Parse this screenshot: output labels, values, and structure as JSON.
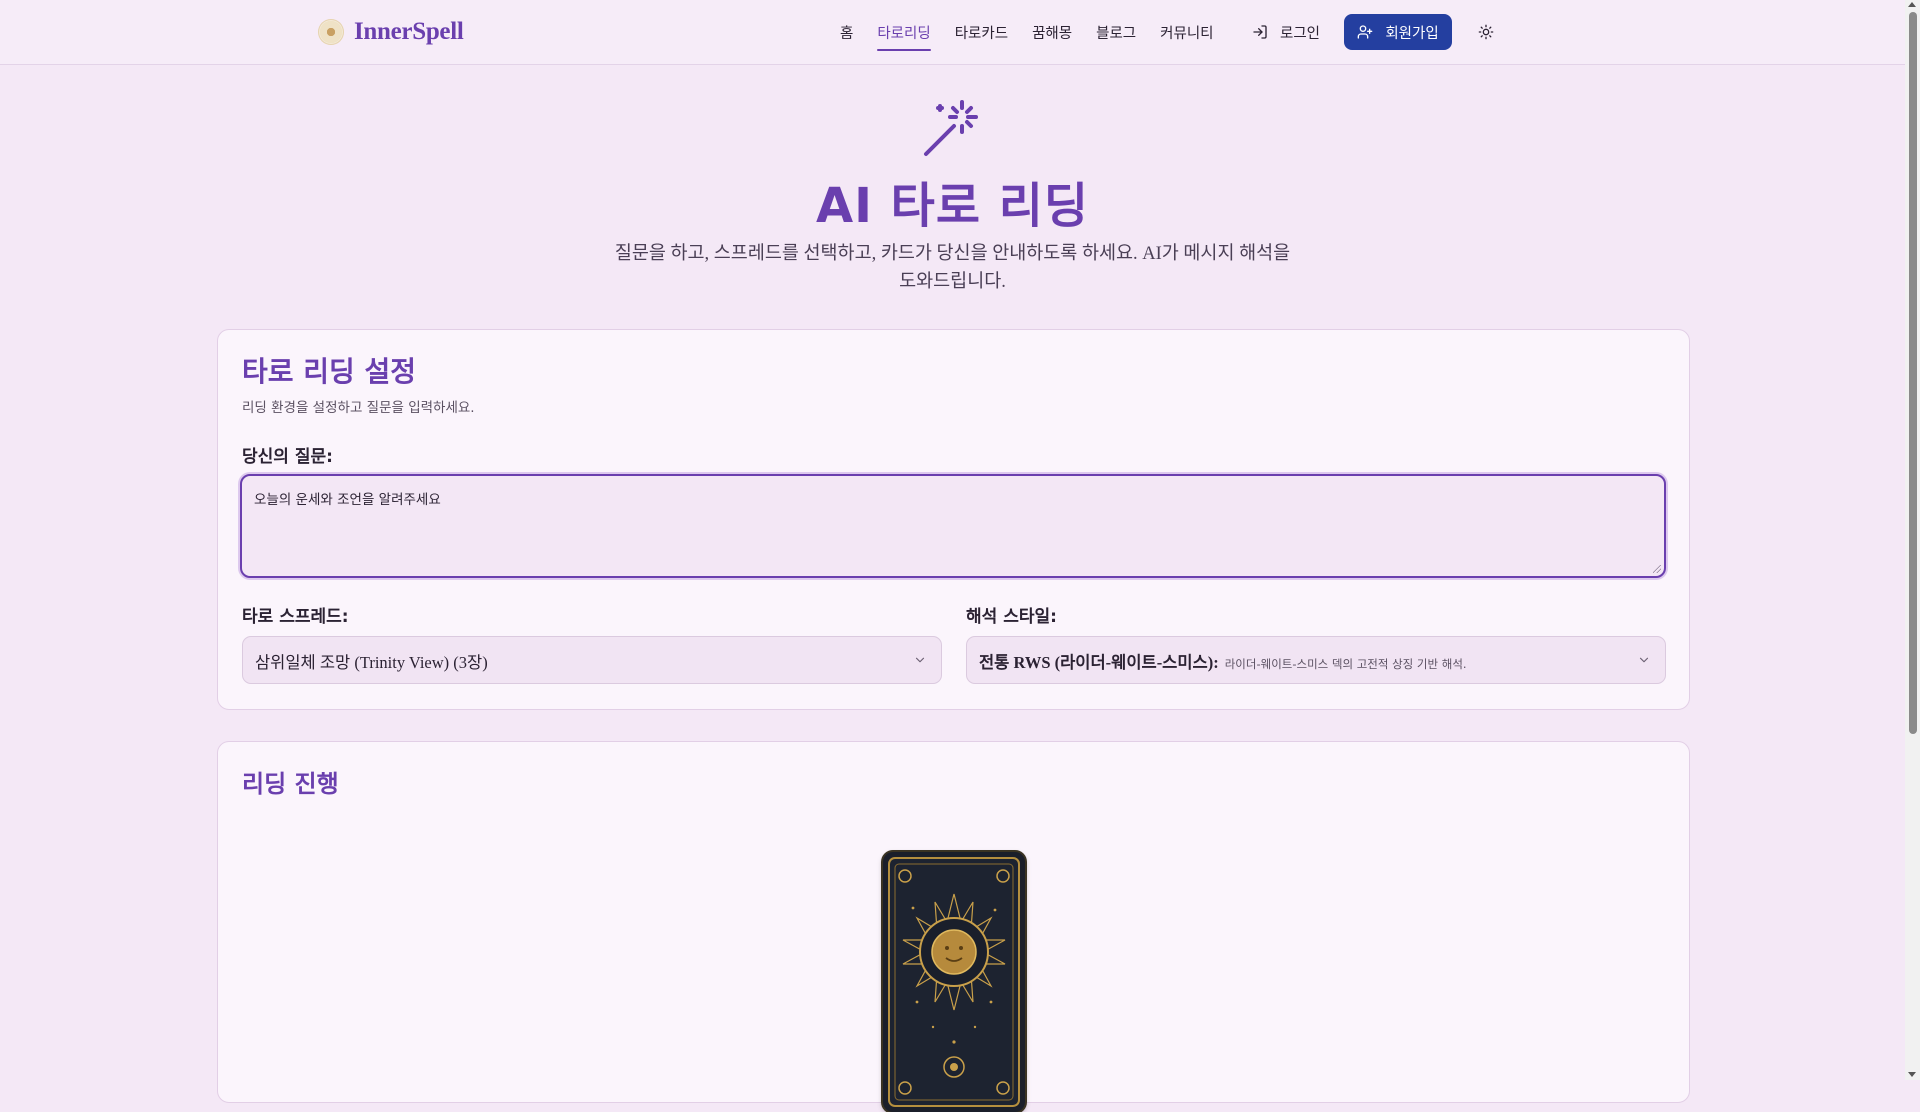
{
  "header": {
    "logo_text": "InnerSpell",
    "nav": [
      {
        "label": "홈",
        "active": false
      },
      {
        "label": "타로리딩",
        "active": true
      },
      {
        "label": "타로카드",
        "active": false
      },
      {
        "label": "꿈해몽",
        "active": false
      },
      {
        "label": "블로그",
        "active": false
      },
      {
        "label": "커뮤니티",
        "active": false
      }
    ],
    "login_label": "로그인",
    "signup_label": "회원가입"
  },
  "hero": {
    "title": "AI 타로 리딩",
    "subtitle": "질문을 하고, 스프레드를 선택하고, 카드가 당신을 안내하도록 하세요. AI가 메시지 해석을 도와드립니다."
  },
  "settings": {
    "title": "타로 리딩 설정",
    "description": "리딩 환경을 설정하고 질문을 입력하세요.",
    "question_label": "당신의 질문:",
    "question_value": "오늘의 운세와 조언을 알려주세요",
    "spread_label": "타로 스프레드:",
    "spread_value": "삼위일체 조망 (Trinity View) (3장)",
    "style_label": "해석 스타일:",
    "style_value": "전통 RWS (라이더-웨이트-스미스):",
    "style_desc": "라이더-웨이트-스미스 덱의 고전적 상징 기반 해석."
  },
  "progress": {
    "title": "리딩 진행"
  },
  "colors": {
    "accent": "#6a3fae",
    "signup_bg": "#243fa0",
    "page_bg": "#f4e8f6"
  },
  "icons": [
    "magic-wand-icon",
    "login-icon",
    "user-plus-icon",
    "sun-icon",
    "chevron-down-icon"
  ]
}
